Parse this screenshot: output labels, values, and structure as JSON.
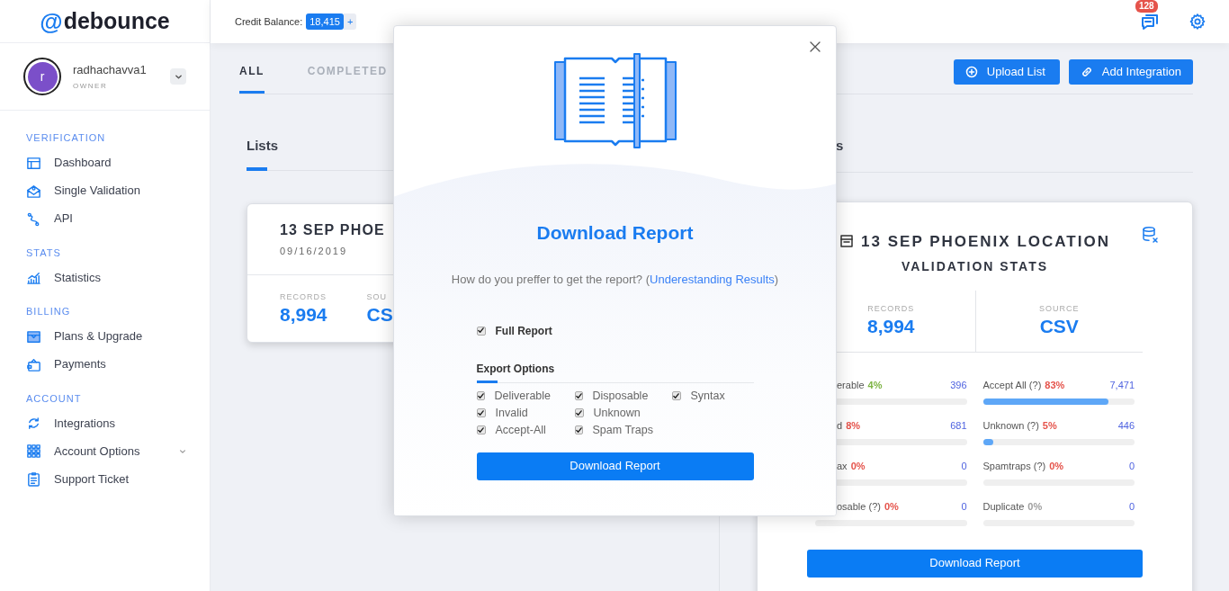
{
  "brand": {
    "mark": "@",
    "name": "debounce"
  },
  "header": {
    "credit_label": "Credit Balance:",
    "credit_value": "18,415",
    "credit_add": "+",
    "notifications": "128"
  },
  "user": {
    "avatar_letter": "r",
    "name": "radhachavva1",
    "role": "OWNER"
  },
  "sidebar": {
    "sections": [
      {
        "title": "VERIFICATION",
        "items": [
          {
            "label": "Dashboard"
          },
          {
            "label": "Single Validation"
          },
          {
            "label": "API"
          }
        ]
      },
      {
        "title": "STATS",
        "items": [
          {
            "label": "Statistics"
          }
        ]
      },
      {
        "title": "BILLING",
        "items": [
          {
            "label": "Plans & Upgrade"
          },
          {
            "label": "Payments"
          }
        ]
      },
      {
        "title": "ACCOUNT",
        "items": [
          {
            "label": "Integrations"
          },
          {
            "label": "Account Options",
            "expandable": true
          },
          {
            "label": "Support Ticket"
          }
        ]
      }
    ]
  },
  "tabs": [
    {
      "label": "ALL",
      "selected": true
    },
    {
      "label": "COMPLETED",
      "selected": false
    }
  ],
  "actions": [
    {
      "label": "Upload List"
    },
    {
      "label": "Add Integration"
    }
  ],
  "lists": {
    "title": "Lists",
    "card": {
      "name": "13 SEP PHOE",
      "date": "09/16/2019",
      "records_label": "RECORDS",
      "records": "8,994",
      "source_label": "SOU",
      "source": "CS"
    }
  },
  "stats_panel": {
    "title": "s",
    "card": {
      "name": "13 SEP PHOENIX LOCATION",
      "subtitle": "VALIDATION STATS",
      "records_label": "RECORDS",
      "records": "8,994",
      "source_label": "SOURCE",
      "source": "CSV",
      "metrics": [
        {
          "label": "erable",
          "percent": "4%",
          "color": "#7cb342",
          "count": "396"
        },
        {
          "label": "Accept All (?)",
          "percent": "83%",
          "color": "#e5534b",
          "count": "7,471",
          "level": 0.83
        },
        {
          "label": "d",
          "percent": "8%",
          "color": "#e5534b",
          "count": "681"
        },
        {
          "label": "Unknown (?)",
          "percent": "5%",
          "color": "#e5534b",
          "count": "446",
          "level": 0.05
        },
        {
          "label": "ax",
          "percent": "0%",
          "color": "#e5534b",
          "count": "0"
        },
        {
          "label": "Spamtraps (?)",
          "percent": "0%",
          "color": "#e5534b",
          "count": "0",
          "level": 0
        },
        {
          "label": "osable (?)",
          "percent": "0%",
          "color": "#e5534b",
          "count": "0"
        },
        {
          "label": "Duplicate",
          "percent": "0%",
          "color": "#9e9e9e",
          "count": "0",
          "level": 0
        }
      ],
      "button": "Download Report"
    }
  },
  "modal": {
    "title": "Download Report",
    "prompt": "How do you preffer to get the report? (",
    "link": "Underestanding Results",
    "prompt_end": ")",
    "full_report": {
      "label": "Full Report",
      "checked": true
    },
    "export_title": "Export Options",
    "options": [
      {
        "label": "Deliverable",
        "checked": true
      },
      {
        "label": "Invalid",
        "checked": true
      },
      {
        "label": "Accept-All",
        "checked": true
      },
      {
        "label": "Disposable",
        "checked": true
      },
      {
        "label": "Unknown",
        "checked": true
      },
      {
        "label": "Spam Traps",
        "checked": true
      },
      {
        "label": "Syntax",
        "checked": true
      }
    ],
    "button": "Download Report"
  }
}
